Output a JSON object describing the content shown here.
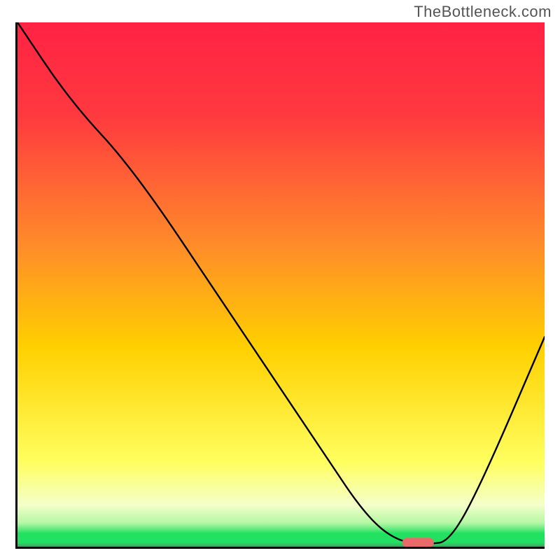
{
  "watermark": "TheBottleneck.com",
  "chart_data": {
    "type": "line",
    "title": "",
    "xlabel": "",
    "ylabel": "",
    "xlim": [
      0,
      100
    ],
    "ylim": [
      0,
      100
    ],
    "background_gradient": {
      "top": "#ff2244",
      "mid_upper": "#ff8a2a",
      "mid": "#ffd000",
      "mid_lower": "#ffff60",
      "green": "#22e060",
      "bottom_shadow": "#48a068"
    },
    "curve": {
      "description": "V-shaped bottleneck curve",
      "x": [
        0,
        10,
        22,
        40,
        58,
        66,
        72,
        78,
        82,
        88,
        100
      ],
      "y": [
        100,
        85,
        72,
        45,
        18,
        6,
        1,
        0.5,
        1,
        12,
        40
      ]
    },
    "marker": {
      "description": "optimal point pill marker",
      "x_center": 76,
      "y_center": 0.8,
      "color": "#e96a6a",
      "width_frac": 0.06,
      "height_frac": 0.018
    },
    "axes": {
      "show_ticks": false,
      "show_grid": false
    }
  }
}
